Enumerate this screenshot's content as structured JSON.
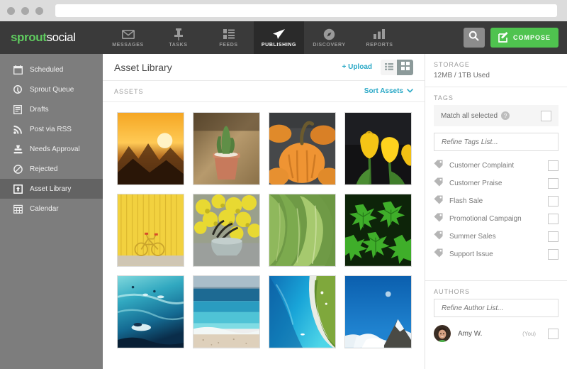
{
  "browser": {
    "address_value": "",
    "address_placeholder": ""
  },
  "topnav": {
    "brand_primary": "sprout",
    "brand_secondary": "social",
    "items": [
      {
        "label": "MESSAGES",
        "icon": "envelope-icon",
        "active": false
      },
      {
        "label": "TASKS",
        "icon": "pin-icon",
        "active": false
      },
      {
        "label": "FEEDS",
        "icon": "feeds-icon",
        "active": false
      },
      {
        "label": "PUBLISHING",
        "icon": "paper-plane-icon",
        "active": true
      },
      {
        "label": "DISCOVERY",
        "icon": "compass-icon",
        "active": false
      },
      {
        "label": "REPORTS",
        "icon": "bar-chart-icon",
        "active": false
      }
    ],
    "search_icon": "search-icon",
    "compose_label": "COMPOSE"
  },
  "sidebar": {
    "items": [
      {
        "label": "Scheduled",
        "icon": "calendar-icon",
        "active": false
      },
      {
        "label": "Sprout Queue",
        "icon": "sprout-queue-icon",
        "active": false
      },
      {
        "label": "Drafts",
        "icon": "document-icon",
        "active": false
      },
      {
        "label": "Post via RSS",
        "icon": "rss-icon",
        "active": false
      },
      {
        "label": "Needs Approval",
        "icon": "stamp-icon",
        "active": false
      },
      {
        "label": "Rejected",
        "icon": "ban-icon",
        "active": false
      },
      {
        "label": "Asset Library",
        "icon": "upload-box-icon",
        "active": true
      },
      {
        "label": "Calendar",
        "icon": "calendar-grid-icon",
        "active": false
      }
    ]
  },
  "content": {
    "title": "Asset Library",
    "upload_label": "+ Upload",
    "view_list_icon": "list-view-icon",
    "view_grid_icon": "grid-view-icon",
    "assets_label": "ASSETS",
    "sort_label": "Sort Assets",
    "sort_chevron": "chevron-down-icon",
    "assets": [
      {
        "name": "sunset-mountains"
      },
      {
        "name": "potted-cactus"
      },
      {
        "name": "pumpkins"
      },
      {
        "name": "yellow-tulips"
      },
      {
        "name": "bicycle-yellow-wall"
      },
      {
        "name": "yellow-flowers"
      },
      {
        "name": "green-leaves"
      },
      {
        "name": "green-maple-leaves"
      },
      {
        "name": "surfer-ocean"
      },
      {
        "name": "beach-shoreline"
      },
      {
        "name": "aerial-coastline"
      },
      {
        "name": "snowy-mountain-peak"
      }
    ]
  },
  "rightpanel": {
    "storage": {
      "heading": "STORAGE",
      "value": "12MB / 1TB Used"
    },
    "tags": {
      "heading": "TAGS",
      "match_all_label": "Match all selected",
      "help_icon": "question-mark-icon",
      "refine_placeholder": "Refine Tags List...",
      "refine_value": "",
      "items": [
        {
          "label": "Customer Complaint",
          "checked": false
        },
        {
          "label": "Customer Praise",
          "checked": false
        },
        {
          "label": "Flash Sale",
          "checked": false
        },
        {
          "label": "Promotional Campaign",
          "checked": false
        },
        {
          "label": "Summer Sales",
          "checked": false
        },
        {
          "label": "Support Issue",
          "checked": false
        }
      ]
    },
    "authors": {
      "heading": "AUTHORS",
      "refine_placeholder": "Refine Author List...",
      "refine_value": "",
      "items": [
        {
          "name": "Amy W.",
          "badge": "(You)",
          "checked": false
        }
      ]
    }
  },
  "colors": {
    "brand_green": "#5fca5f",
    "accent_teal": "#29a8c6",
    "nav_dark": "#3a3a3a",
    "sidebar_gray": "#7d7d7d"
  }
}
